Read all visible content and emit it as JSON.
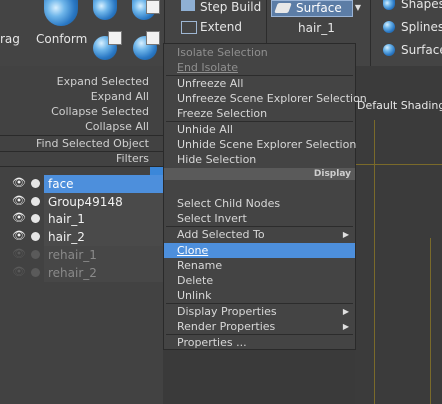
{
  "ribbon": {
    "frag_label": "rag",
    "conform_label": "Conform",
    "step_build_label": "Step Build",
    "extend_label": "Extend",
    "surface_button_label": "Surface",
    "hair_label": "hair_1",
    "shapes_label": "Shapes",
    "splines_label": "Splines",
    "surface_label": "Surface"
  },
  "left_menu": {
    "items": [
      "Expand Selected",
      "Expand All",
      "Collapse Selected",
      "Collapse All",
      "Find Selected Object",
      "Filters"
    ]
  },
  "scene_list": {
    "rows": [
      {
        "name": "face"
      },
      {
        "name": "Group49148"
      },
      {
        "name": "hair_1"
      },
      {
        "name": "hair_2"
      },
      {
        "name": "rehair_1"
      },
      {
        "name": "rehair_2"
      }
    ]
  },
  "viewport": {
    "label": "Default Shading ]"
  },
  "context_menu": {
    "isolate_selection": "Isolate Selection",
    "end_isolate": "End Isolate",
    "unfreeze_all": "Unfreeze All",
    "unfreeze_scene_explorer": "Unfreeze Scene Explorer Selection",
    "freeze_selection": "Freeze Selection",
    "unhide_all": "Unhide All",
    "unhide_scene_explorer": "Unhide Scene Explorer Selection",
    "hide_selection": "Hide Selection",
    "display_header": "Display",
    "select_child_nodes": "Select Child Nodes",
    "select_invert": "Select Invert",
    "add_selected_to": "Add Selected To",
    "clone": "Clone",
    "rename": "Rename",
    "delete": "Delete",
    "unlink": "Unlink",
    "display_properties": "Display Properties",
    "render_properties": "Render Properties",
    "properties": "Properties ..."
  },
  "colors": {
    "highlight": "#4d8fdc",
    "panel": "#444444"
  }
}
